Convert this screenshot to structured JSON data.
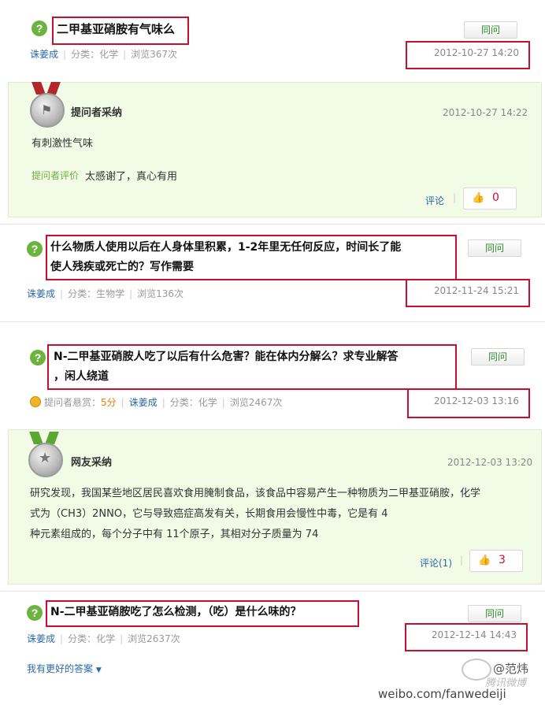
{
  "questions": [
    {
      "title": "二甲基亚硝胺有气味么",
      "user": "诛姜成",
      "category": "分类：化学",
      "views": "浏览367次",
      "date": "2012-10-27 14:20",
      "same_label": "同问"
    },
    {
      "title_line1": "什么物质人使用以后在人身体里积累，1-2年里无任何反应，时间长了能",
      "title_line2": "使人残疾或死亡的？写作需要",
      "user": "诛姜成",
      "category": "分类：生物学",
      "views": "浏览136次",
      "date": "2012-11-24 15:21",
      "same_label": "同问"
    },
    {
      "title_line1": "N-二甲基亚硝胺人吃了以后有什么危害？能在体内分解么？求专业解答",
      "title_line2": "，闲人绕道",
      "reward_label": "提问者悬赏：",
      "reward": "5分",
      "user": "诛姜成",
      "category": "分类：化学",
      "views": "浏览2467次",
      "date": "2012-12-03 13:16",
      "same_label": "同问"
    },
    {
      "title": "N-二甲基亚硝胺吃了怎么检测，（吃）是什么味的？",
      "user": "诛姜成",
      "category": "分类：化学",
      "views": "浏览2637次",
      "date": "2012-12-14 14:43",
      "same_label": "同问"
    }
  ],
  "answers": [
    {
      "adopt_label": "提问者采纳",
      "date": "2012-10-27 14:22",
      "text": "有刺激性气味",
      "eval_label": "提问者评价",
      "eval_text": "太感谢了，真心有用",
      "comment_label": "评论",
      "likes": "0"
    },
    {
      "adopt_label": "网友采纳",
      "date": "2012-12-03 13:20",
      "text_line1": "研究发现，我国某些地区居民喜欢食用腌制食品，该食品中容易产生一种物质为二甲基亚硝胺，化学",
      "text_line2": "式为（CH3）2NNO，它与导致癌症高发有关，长期食用会慢性中毒，它是有 4",
      "text_line3": "种元素组成的，每个分子中有 11个原子，其相对分子质量为 74",
      "comment_label": "评论(1)",
      "likes": "3"
    }
  ],
  "footer": {
    "better_answer": "我有更好的答案",
    "watermark_handle": "@范炜",
    "watermark_brand": "腾讯微博",
    "watermark_url": "weibo.com/fanwedeiji"
  },
  "colors": {
    "highlight_border": "#c8102e",
    "panel_bg": "#f1fbe6",
    "link": "#2a6aa5",
    "q_icon": "#6db33f"
  },
  "icons": [
    "question-icon",
    "medal-icon",
    "thumb-up-icon",
    "coin-icon",
    "chevron-down-icon",
    "weibo-logo-icon"
  ]
}
